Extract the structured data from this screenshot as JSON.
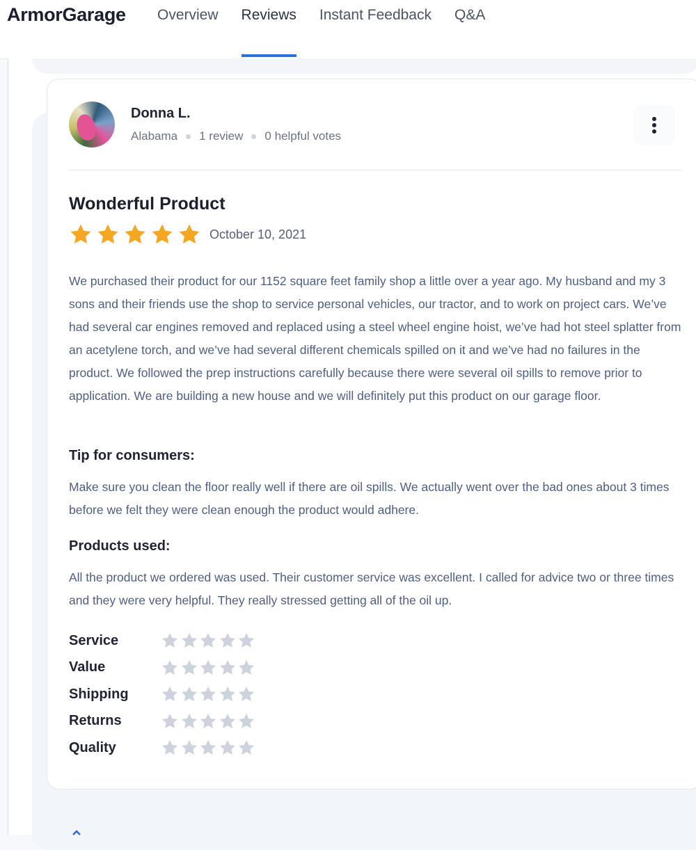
{
  "brand": "ArmorGarage",
  "nav": {
    "tabs": [
      "Overview",
      "Reviews",
      "Instant Feedback",
      "Q&A"
    ],
    "active": "Reviews"
  },
  "review": {
    "reviewer": {
      "name": "Donna L.",
      "location": "Alabama",
      "review_count": "1 review",
      "helpful_votes": "0 helpful votes"
    },
    "title": "Wonderful Product",
    "rating": 5,
    "date": "October 10, 2021",
    "body": "We purchased their product for our 1152 square feet family shop a little over a year ago. My husband and my 3 sons and their friends use the shop to service personal vehicles, our tractor, and to work on project cars. We’ve had several car engines removed and replaced using a steel wheel engine hoist, we’ve had hot steel splatter from an acetylene torch, and we’ve had several different chemicals spilled on it and we’ve had no failures in the product. We followed the prep instructions carefully because there were several oil spills to remove prior to application. We are building a new house and we will definitely put this product on our garage floor.",
    "tip_heading": "Tip for consumers:",
    "tip_text": "Make sure you clean the floor really well if there are oil spills. We actually went over the bad ones about 3 times before we felt they were clean enough the product would adhere.",
    "products_heading": "Products used:",
    "products_text": "All the product we ordered was used. Their customer service was excellent. I called for advice two or three times and they were very helpful. They really stressed getting all of the oil up.",
    "sub_ratings": [
      {
        "label": "Service",
        "stars": 0
      },
      {
        "label": "Value",
        "stars": 0
      },
      {
        "label": "Shipping",
        "stars": 0
      },
      {
        "label": "Returns",
        "stars": 0
      },
      {
        "label": "Quality",
        "stars": 0
      }
    ]
  },
  "colors": {
    "accent": "#2a6ee0",
    "star_filled": "#f5a623",
    "star_empty": "#cdd3dd"
  },
  "icons": {
    "more": "vertical-dots-icon",
    "star": "star-icon"
  }
}
